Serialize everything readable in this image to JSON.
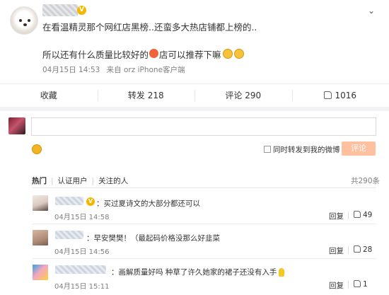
{
  "post": {
    "line1": "在看温精灵那个网红店黑榜..还蛮多大热店铺都上榜的..",
    "line2_before": "所以还有什么质量比较好的",
    "line2_after": "店可以推荐下嘛",
    "date": "04月15日 14:53",
    "source": "来自 orz iPhone客户端",
    "vip_badge": "V"
  },
  "actions": {
    "favorite": "收藏",
    "repost": "转发 218",
    "comment": "评论 290",
    "like": "1016"
  },
  "compose": {
    "forward_label": "同时转发到我的微博",
    "submit_label": "评论"
  },
  "filters": {
    "tabs": [
      "热门",
      "认证用户",
      "关注的人"
    ],
    "total": "共290条"
  },
  "comments": [
    {
      "text": "：买过夏诗文的大部分都还可以",
      "time": "04月15日 14:58",
      "reply": "回复",
      "likes": "49"
    },
    {
      "text": "：早安樊樊！（最起码价格没那么好韭菜",
      "time": "04月15日 14:56",
      "reply": "回复",
      "likes": "28"
    },
    {
      "text": "：画解质量好吗 种草了许久她家的裙子还没有入手",
      "time": "04月15日 15:11",
      "reply": "回复",
      "likes": "1"
    }
  ],
  "colors": {
    "submit_bg": "#ffc09f",
    "badge": "#f5b600"
  },
  "icons": [
    "more-icon",
    "like-icon",
    "smile-icon",
    "bulb-emoji-icon",
    "orange-emoji-icon",
    "cry-emoji-icon"
  ]
}
